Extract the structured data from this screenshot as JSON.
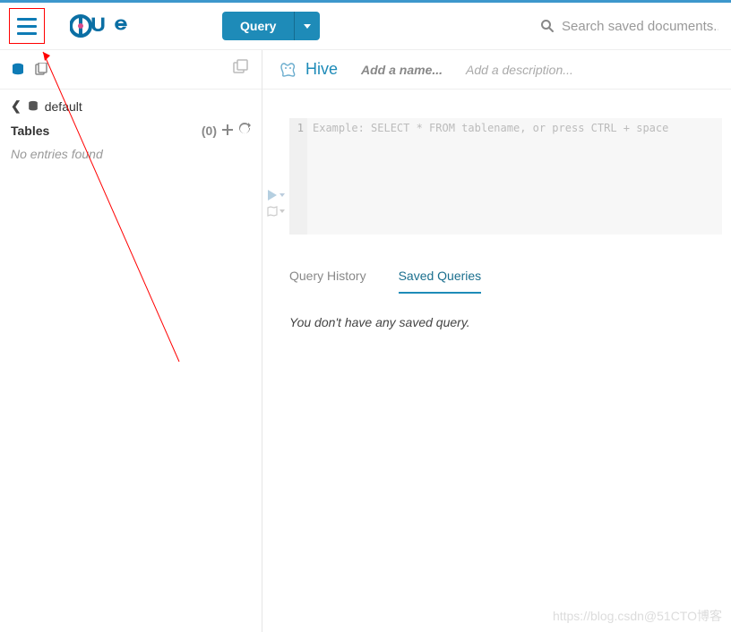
{
  "topbar": {
    "query_label": "Query",
    "search_placeholder": "Search saved documents..."
  },
  "sidebar": {
    "db_label": "default",
    "tables_label": "Tables",
    "tables_count": "(0)",
    "no_entries": "No entries found"
  },
  "main": {
    "engine": "Hive",
    "name_placeholder": "Add a name...",
    "desc_placeholder": "Add a description...",
    "editor_line_number": "1",
    "editor_placeholder": "Example: SELECT * FROM tablename, or press CTRL + space",
    "tabs": {
      "history_label": "Query History",
      "saved_label": "Saved Queries"
    },
    "empty_saved": "You don't have any saved query."
  },
  "watermark": "https://blog.csdn@51CTO博客"
}
